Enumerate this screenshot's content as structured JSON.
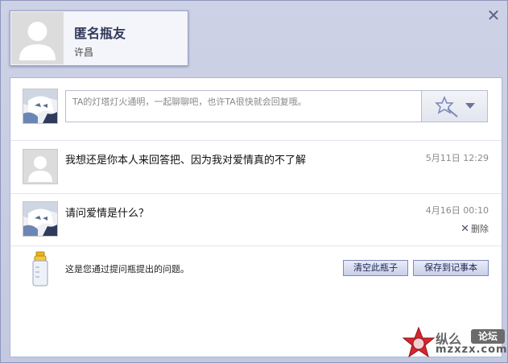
{
  "profile": {
    "name": "匿名瓶友",
    "location": "许昌"
  },
  "close_icon": "close-icon",
  "compose": {
    "placeholder": "TA的灯塔灯火通明，一起聊聊吧，也许TA很快就会回复哦。",
    "emote_icon": "star-wand-icon"
  },
  "messages": [
    {
      "text": "我想还是你本人来回答把、因为我对爱情真的不了解",
      "time": "5月11日 12:29",
      "avatar": "default-user-avatar"
    },
    {
      "text": "请问爱情是什么？",
      "time": "4月16日 00:10",
      "delete_label": "删除",
      "avatar": "anime-avatar"
    }
  ],
  "footer": {
    "text": "这是您通过提问瓶提出的问题。",
    "clear_button": "清空此瓶子",
    "save_button": "保存到记事本",
    "bottle_icon": "bottle-icon"
  },
  "watermark": {
    "top": "纵么",
    "badge": "论坛",
    "url": "mzxzx.com"
  },
  "colors": {
    "window_bg": "#c5cbe2",
    "panel_bg": "#ffffff",
    "button_border": "#7e88bd",
    "title_text": "#333a5a"
  }
}
